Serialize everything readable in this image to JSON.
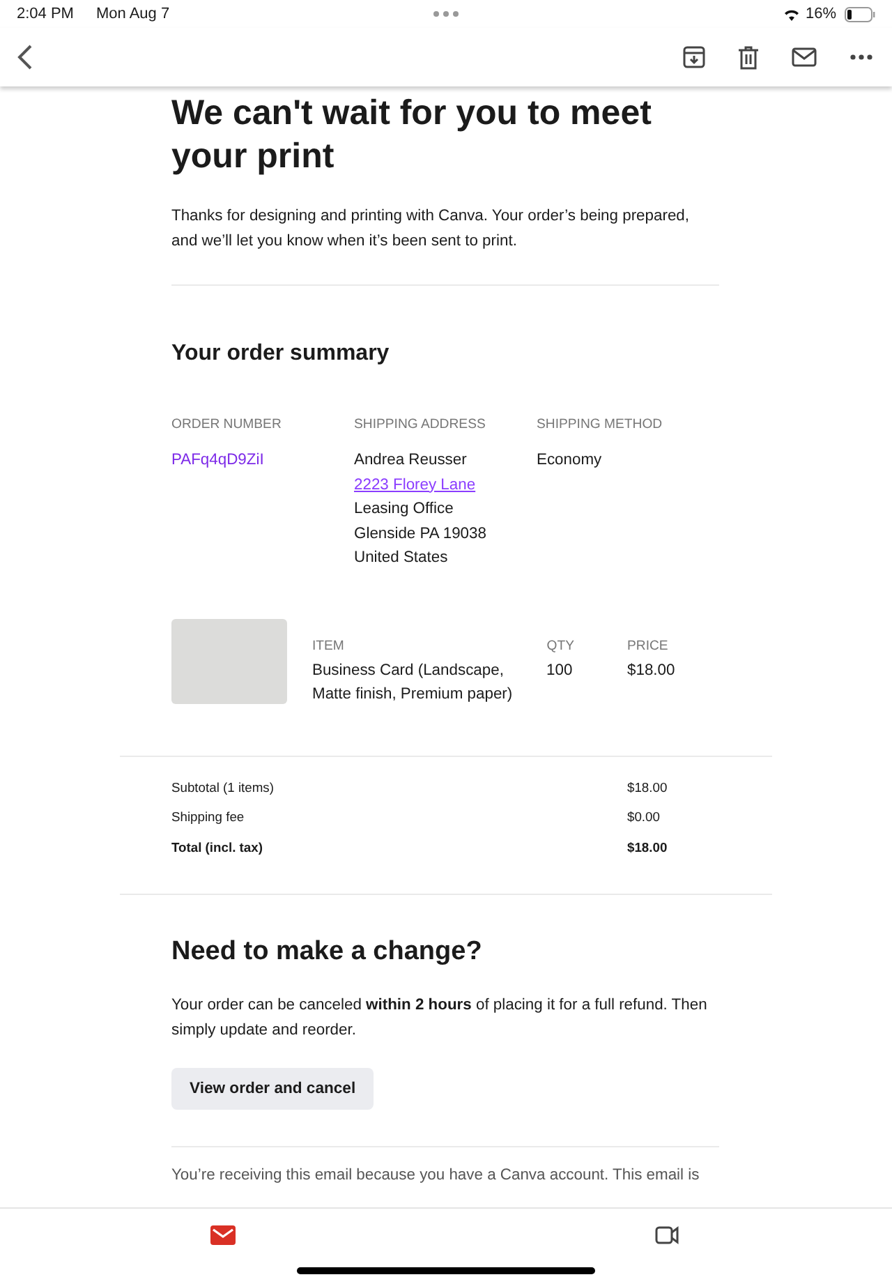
{
  "status_bar": {
    "time": "2:04 PM",
    "date": "Mon Aug 7",
    "battery": "16%"
  },
  "email": {
    "heading": "We can't wait for you to meet your print",
    "intro": "Thanks for designing and printing with Canva. Your order’s being prepared, and we’ll let you know when it’s been sent to print.",
    "summary_title": "Your order summary",
    "order": [
      {
        "label": "ORDER NUMBER",
        "lines": [
          "PAFq4qD9ZiI"
        ],
        "kind": "link"
      },
      {
        "label": "SHIPPING ADDRESS",
        "lines": [
          "Andrea Reusser",
          "2223 Florey Lane",
          "Leasing Office",
          "Glenside PA 19038",
          "United States"
        ],
        "kind": "address"
      },
      {
        "label": "SHIPPING METHOD",
        "lines": [
          "Economy"
        ],
        "kind": "text"
      }
    ],
    "item_columns": [
      "ITEM",
      "QTY",
      "PRICE"
    ],
    "item": {
      "name": "Business Card (Landscape, Matte finish, Premium paper)",
      "qty": "100",
      "price": "$18.00"
    },
    "totals": [
      {
        "label": "Subtotal (1 items)",
        "value": "$18.00",
        "bold": false
      },
      {
        "label": "Shipping fee",
        "value": "$0.00",
        "bold": false
      },
      {
        "label": "Total (incl. tax)",
        "value": "$18.00",
        "bold": true
      }
    ],
    "change_title": "Need to make a change?",
    "change_text": "Your order can be canceled **within 2 hours** of placing it for a full refund. Then simply update and reorder.",
    "button": "View order and cancel",
    "footer": "You’re receiving this email because you have a Canva account. This email is"
  },
  "bottom_tabs": [
    {
      "kind": "mail",
      "selected": true
    },
    {
      "kind": "video",
      "selected": false
    }
  ]
}
